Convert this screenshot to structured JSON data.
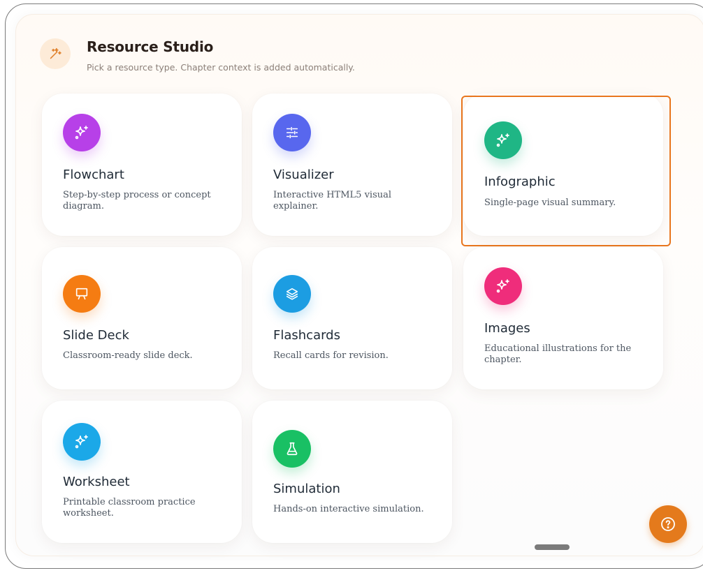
{
  "header": {
    "icon": "magic-wand-icon",
    "title": "Resource Studio",
    "subtitle": "Pick a resource type. Chapter context is added automatically."
  },
  "cards": [
    {
      "label": "Flowchart",
      "desc": "Step-by-step process or concept diagram.",
      "icon": "sparkles-icon",
      "color": "#b740e8"
    },
    {
      "label": "Visualizer",
      "desc": "Interactive HTML5 visual explainer.",
      "icon": "sliders-icon",
      "color": "#5867ee"
    },
    {
      "label": "Infographic",
      "desc": "Single-page visual summary.",
      "icon": "sparkles-icon",
      "color": "#1fb685",
      "selected": true
    },
    {
      "label": "Slide Deck",
      "desc": "Classroom-ready slide deck.",
      "icon": "presentation-icon",
      "color": "#f57c12"
    },
    {
      "label": "Flashcards",
      "desc": "Recall cards for revision.",
      "icon": "layers-icon",
      "color": "#1c9de2"
    },
    {
      "label": "Images",
      "desc": "Educational illustrations for the chapter.",
      "icon": "sparkles-icon",
      "color": "#ef2d7b"
    },
    {
      "label": "Worksheet",
      "desc": "Printable classroom practice worksheet.",
      "icon": "sparkles-icon",
      "color": "#1ba8e8"
    },
    {
      "label": "Simulation",
      "desc": "Hands-on interactive simulation.",
      "icon": "flask-icon",
      "color": "#19c064"
    }
  ],
  "help_button": {
    "icon": "help-circle-icon",
    "color": "#e47a1c"
  }
}
